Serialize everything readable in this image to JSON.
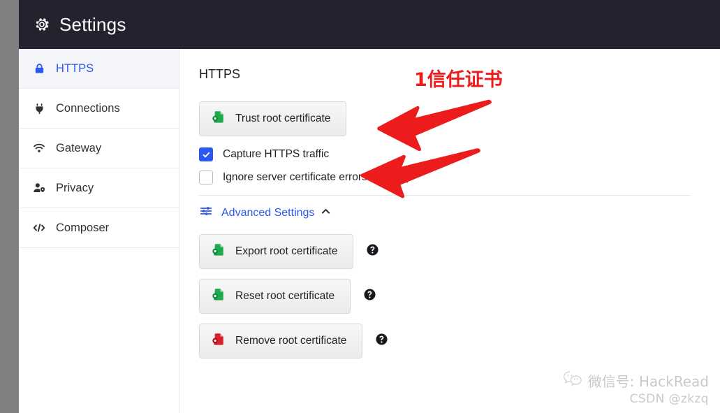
{
  "window": {
    "title": "Settings",
    "title_icon": "gear-icon"
  },
  "sidebar": {
    "items": [
      {
        "label": "HTTPS",
        "icon": "lock-icon",
        "active": true
      },
      {
        "label": "Connections",
        "icon": "plug-icon",
        "active": false
      },
      {
        "label": "Gateway",
        "icon": "wifi-icon",
        "active": false
      },
      {
        "label": "Privacy",
        "icon": "user-shield-icon",
        "active": false
      },
      {
        "label": "Composer",
        "icon": "code-icon",
        "active": false
      }
    ]
  },
  "main": {
    "section_title": "HTTPS",
    "trust_button": {
      "label": "Trust root certificate",
      "icon": "certificate-green-icon"
    },
    "checkboxes": [
      {
        "label": "Capture HTTPS traffic",
        "checked": true
      },
      {
        "label": "Ignore server certificate errors (unsafe)",
        "checked": false
      }
    ],
    "advanced": {
      "label": "Advanced Settings",
      "icon": "sliders-icon",
      "chevron": "chevron-up-icon",
      "expanded": true
    },
    "advanced_buttons": [
      {
        "label": "Export root certificate",
        "icon": "certificate-green-icon",
        "help": "help-icon"
      },
      {
        "label": "Reset root certificate",
        "icon": "certificate-green-icon",
        "help": "help-icon"
      },
      {
        "label": "Remove root certificate",
        "icon": "certificate-red-icon",
        "help": "help-icon"
      }
    ]
  },
  "annotations": {
    "callout_text": "1信任证书",
    "arrow_count": 2,
    "color": "#ec1c1c"
  },
  "watermark": {
    "line1": "微信号: HackRead",
    "line2": "CSDN @zkzq",
    "icon": "wechat-icon"
  },
  "colors": {
    "header_bg": "#23232f",
    "accent_blue": "#2b58f3",
    "active_item_bg": "#f4f5f8",
    "cert_green": "#1faa4b",
    "cert_red": "#d9202a",
    "annotation_red": "#ec1c1c",
    "page_bg": "#ffffff",
    "outer_bg": "#808080"
  }
}
